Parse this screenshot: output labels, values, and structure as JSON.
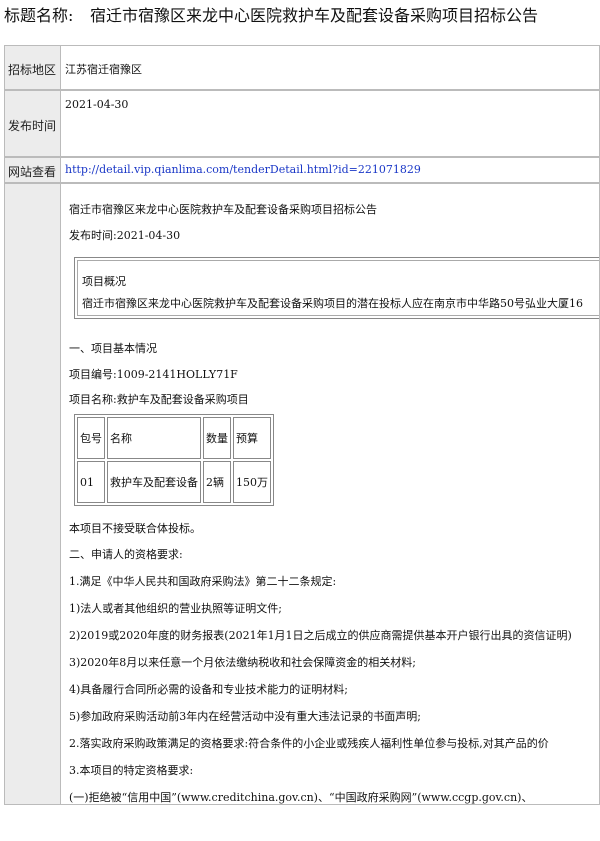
{
  "header": {
    "label": "标题名称:",
    "title": "宿迁市宿豫区来龙中心医院救护车及配套设备采购项目招标公告"
  },
  "fields": [
    {
      "label": "招标地区",
      "value": "江苏宿迁宿豫区"
    },
    {
      "label": "发布时间",
      "value": "2021-04-30"
    },
    {
      "label": "网站查看",
      "value": "http://detail.vip.qianlima.com/tenderDetail.html?id=221071829"
    }
  ],
  "content": {
    "heading": "宿迁市宿豫区来龙中心医院救护车及配套设备采购项目招标公告",
    "publish": "发布时间:2021-04-30",
    "overview_title": "项目概况",
    "overview_text": "宿迁市宿豫区来龙中心医院救护车及配套设备采购项目的潜在投标人应在南京市中华路50号弘业大厦16",
    "sec1": "一、项目基本情况",
    "project_no": "项目编号:1009-2141HOLLY71F",
    "project_name": "项目名称:救护车及配套设备采购项目",
    "table_headers": [
      "包号",
      "名称",
      "数量",
      "预算"
    ],
    "table_row": [
      "01",
      "救护车及配套设备",
      "2辆",
      "150万"
    ],
    "no_consortium": "本项目不接受联合体投标。",
    "sec2": "二、申请人的资格要求:",
    "req1": "1.满足《中华人民共和国政府采购法》第二十二条规定:",
    "req1_1": "1)法人或者其他组织的营业执照等证明文件;",
    "req1_2": "2)2019或2020年度的财务报表(2021年1月1日之后成立的供应商需提供基本开户银行出具的资信证明)",
    "req1_3": "3)2020年8月以来任意一个月依法缴纳税收和社会保障资金的相关材料;",
    "req1_4": "4)具备履行合同所必需的设备和专业技术能力的证明材料;",
    "req1_5": "5)参加政府采购活动前3年内在经营活动中没有重大违法记录的书面声明;",
    "req2": "2.落实政府采购政策满足的资格要求:符合条件的小企业或残疾人福利性单位参与投标,对其产品的价",
    "req3": "3.本项目的特定资格要求:",
    "req3_1": "(一)拒绝被“信用中国”(www.creditchina.gov.cn)、“中国政府采购网”(www.ccgp.gov.cn)、"
  }
}
